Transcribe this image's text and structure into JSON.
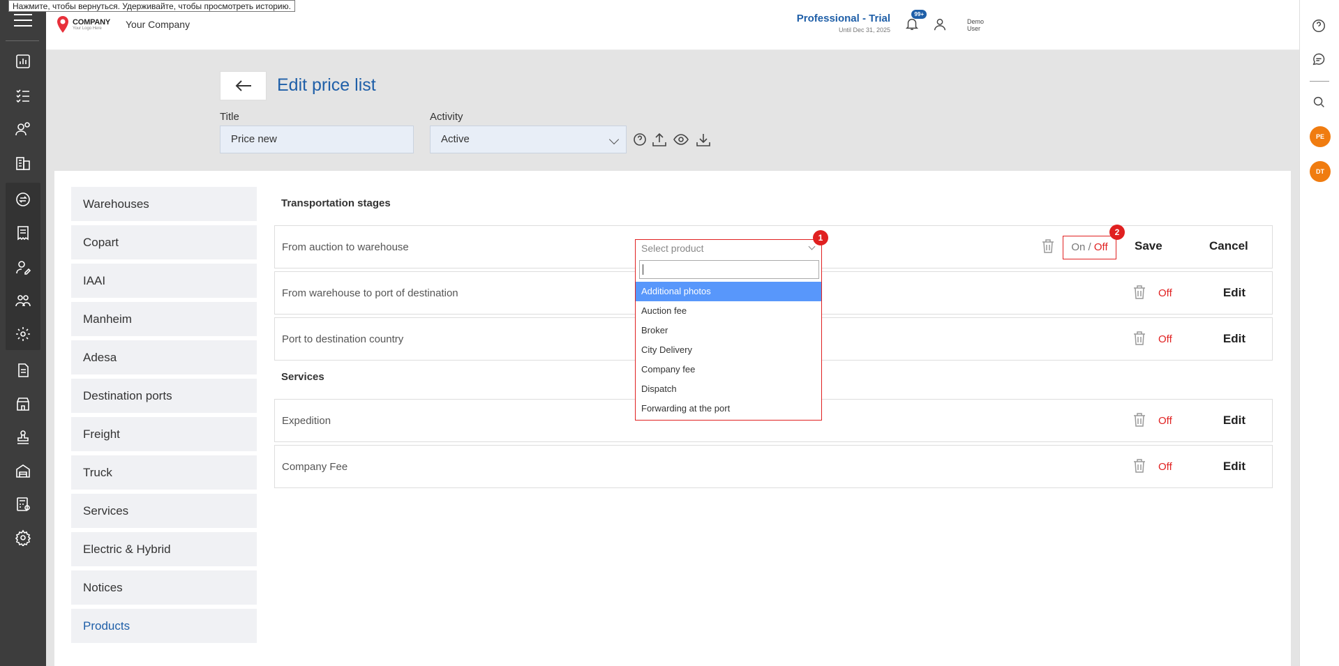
{
  "tooltip": "Нажмите, чтобы вернуться. Удерживайте, чтобы просмотреть историю.",
  "header": {
    "logo_text": "COMPANY",
    "logo_sub": "Your Logo Here",
    "company_name": "Your Company",
    "plan_name": "Professional - Trial",
    "plan_until": "Until Dec 31, 2025",
    "notifications_badge": "99+",
    "user_first": "Demo",
    "user_last": "User"
  },
  "page": {
    "title": "Edit price list",
    "title_label": "Title",
    "title_value": "Price new",
    "activity_label": "Activity",
    "activity_value": "Active"
  },
  "nav": [
    {
      "label": "Warehouses"
    },
    {
      "label": "Copart"
    },
    {
      "label": "IAAI"
    },
    {
      "label": "Manheim"
    },
    {
      "label": "Adesa"
    },
    {
      "label": "Destination ports"
    },
    {
      "label": "Freight"
    },
    {
      "label": "Truck"
    },
    {
      "label": "Services"
    },
    {
      "label": "Electric & Hybrid"
    },
    {
      "label": "Notices"
    },
    {
      "label": "Products"
    }
  ],
  "sections": {
    "transport_title": "Transportation stages",
    "services_title": "Services"
  },
  "rows": [
    {
      "label": "From auction to warehouse"
    },
    {
      "label": "From warehouse to port of destination",
      "status": "Off",
      "action": "Edit"
    },
    {
      "label": "Port to destination country",
      "status": "Off",
      "action": "Edit"
    },
    {
      "label": "Expedition",
      "status": "Off",
      "action": "Edit"
    },
    {
      "label": "Company Fee",
      "status": "Off",
      "action": "Edit"
    }
  ],
  "editing_row": {
    "on_label": "On",
    "slash": " / ",
    "off_label": "Off",
    "save": "Save",
    "cancel": "Cancel"
  },
  "dropdown": {
    "placeholder": "Select product",
    "options": [
      "Additional photos",
      "Auction fee",
      "Broker",
      "City Delivery",
      "Company fee",
      "Dispatch",
      "Forwarding at the port"
    ],
    "highlighted_index": 0
  },
  "markers": {
    "m1": "1",
    "m2": "2"
  },
  "avatars": [
    "PE",
    "DT"
  ],
  "colors": {
    "accent": "#1f5fa8",
    "danger": "#e02020",
    "highlight": "#5897fb",
    "avatar": "#f07c10",
    "sidebar": "#3d3d3d"
  }
}
